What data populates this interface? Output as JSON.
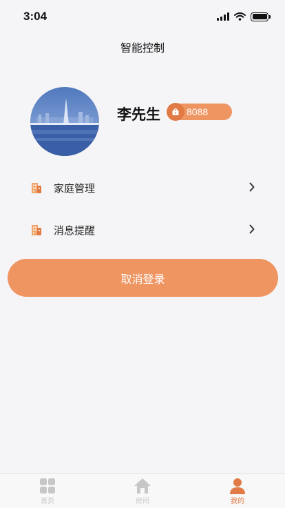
{
  "status_bar": {
    "time": "3:04"
  },
  "header": {
    "title": "智能控制"
  },
  "profile": {
    "name": "李先生",
    "badge_value": "8088"
  },
  "menu": [
    {
      "label": "家庭管理",
      "icon": "building-icon"
    },
    {
      "label": "消息提醒",
      "icon": "building-icon"
    }
  ],
  "logout_label": "取消登录",
  "tabs": [
    {
      "label": "首页",
      "icon": "grid-icon",
      "active": false
    },
    {
      "label": "房间",
      "icon": "house-icon",
      "active": false
    },
    {
      "label": "我的",
      "icon": "person-icon",
      "active": true
    }
  ],
  "colors": {
    "accent": "#ee9562",
    "accent_dark": "#e27a45",
    "background": "#f5f5f7",
    "tab_inactive": "#c7c7c7"
  }
}
